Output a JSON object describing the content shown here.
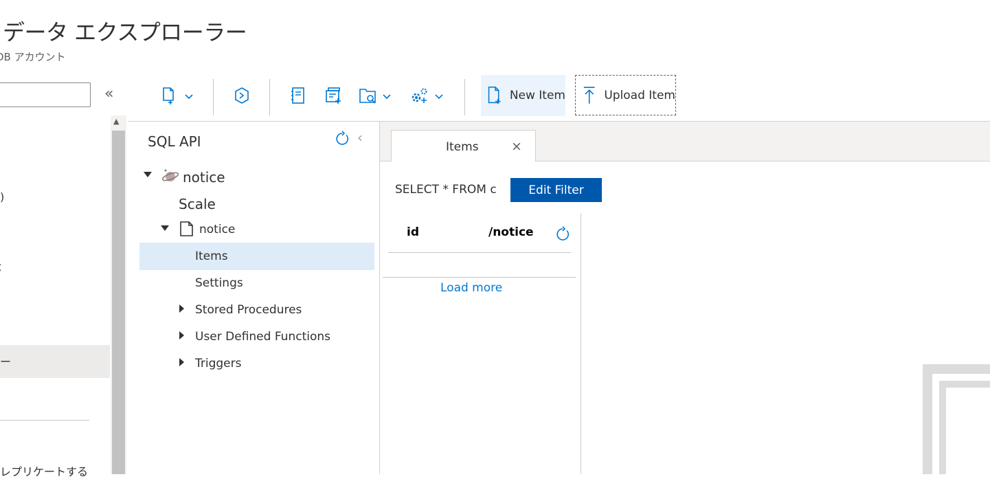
{
  "header": {
    "title": "データ エクスプローラー",
    "subtitle": "DB アカウント"
  },
  "left_nav": {
    "fragments": [
      ")",
      "ー",
      "レプリケートする"
    ]
  },
  "toolbar": {
    "new_item_label": "New Item",
    "upload_item_label": "Upload Item"
  },
  "tree": {
    "title": "SQL API",
    "database": "notice",
    "scale": "Scale",
    "container": "notice",
    "items": "Items",
    "settings": "Settings",
    "stored_procedures": "Stored Procedures",
    "udfs": "User Defined Functions",
    "triggers": "Triggers"
  },
  "tab": {
    "label": "Items",
    "close_glyph": "×"
  },
  "query": {
    "text": "SELECT * FROM c",
    "edit_filter_label": "Edit Filter"
  },
  "grid": {
    "columns": [
      "id",
      "/notice"
    ],
    "load_more": "Load more"
  },
  "colors": {
    "accent": "#0078d4",
    "primary_button": "#0058ad",
    "selection": "#deecf9"
  }
}
